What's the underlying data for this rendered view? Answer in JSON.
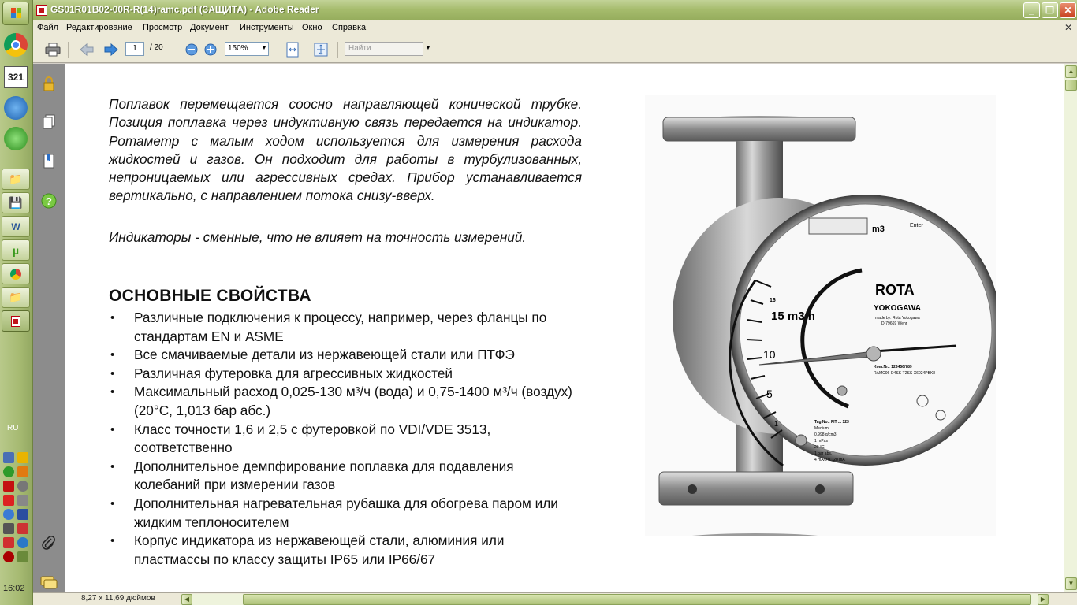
{
  "window": {
    "title": "GS01R01B02-00R-R(14)ramc.pdf (ЗАЩИТА) - Adobe Reader",
    "minimize": "_",
    "maximize": "❐",
    "close": "✕"
  },
  "menu": {
    "items": [
      "Файл",
      "Редактирование",
      "Просмотр",
      "Документ",
      "Инструменты",
      "Окно",
      "Справка"
    ],
    "close_doc": "✕"
  },
  "toolbar": {
    "current_page": "1",
    "total_pages": "/ 20",
    "zoom": "150%",
    "find_placeholder": "Найти"
  },
  "document": {
    "paragraph1": "Поплавок перемещается соосно направляющей конической трубке. Позиция поплавка через индуктивную связь передается на индикатор. Ротаметр с малым ходом используется для измерения расхода жидкостей и газов. Он подходит для работы в турбулизованных, непроницаемых или агрессивных средах. Прибор устанавливается вертикально, с направлением потока снизу-вверх.",
    "paragraph2": "Индикаторы - сменные, что не влияет на точность измерений.",
    "heading": "ОСНОВНЫЕ СВОЙСТВА",
    "features": [
      "Различные подключения к процессу, например, через фланцы по стандартам EN и ASME",
      "Все смачиваемые детали из нержавеющей стали или ПТФЭ",
      "Различная футеровка для агрессивных жидкостей",
      "Максимальный расход 0,025-130 м³/ч (вода) и 0,75-1400 м³/ч (воздух) (20°C, 1,013 бар абс.)",
      "Класс точности 1,6 и 2,5 с футеровкой по VDI/VDE 3513, соответственно",
      "Дополнительное демпфирование поплавка для подавления колебаний при измерении газов",
      "Дополнительная нагревательная рубашка для обогрева паром или жидким теплоносителем",
      "Корпус индикатора из нержавеющей стали, алюминия или пластмассы по классу защиты IP65 или IP66/67"
    ],
    "meter": {
      "unit_display": "m3",
      "enter_label": "Enter",
      "brand": "ROTA",
      "maker": "YOKOGAWA",
      "made_by": "made by: Rota Yokogawa",
      "location": "D-79669 Wehr",
      "scale_title": "15 m3/h",
      "scale_max": "16",
      "scale_ticks": [
        "10",
        "5",
        "1"
      ],
      "tag_no": "Tag No.: FIT ... 123",
      "com_no": "Kom.Nr.: 123456/789",
      "model": "RAMC06-D4SS-T2SS-X6024PBK8",
      "medium_label": "Medium",
      "density": "0,998 g/cm3",
      "viscosity": "1 mPas",
      "temperature": "20 °C",
      "pressure": "1 bar abs.",
      "signal": "4 mA/0 h...20 mA"
    }
  },
  "status": {
    "page_size": "8,27 x 11,69 дюймов"
  },
  "taskbar": {
    "lang": "RU",
    "clock": "16:02"
  }
}
